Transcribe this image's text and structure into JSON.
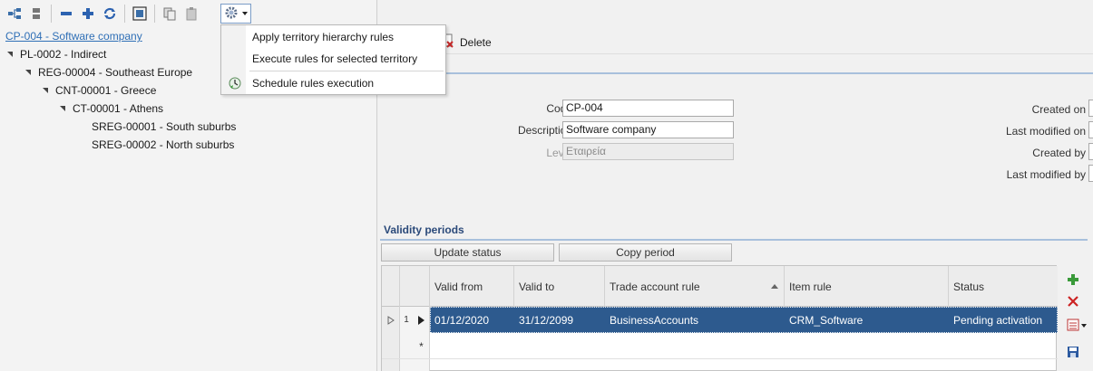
{
  "left_toolbar": {
    "icons": [
      "hierarchy-icon",
      "details-icon",
      "collapse-minus-icon",
      "add-plus-icon",
      "refresh-icon",
      "select-frame-icon",
      "copy-icon",
      "paste-icon",
      "gear-icon"
    ]
  },
  "menu": {
    "items": [
      {
        "label": "Apply territory hierarchy rules",
        "icon": ""
      },
      {
        "label": "Execute rules for selected territory",
        "icon": ""
      },
      {
        "label": "Schedule rules execution",
        "icon": "schedule-icon"
      }
    ]
  },
  "tree": {
    "root": "CP-004 - Software company",
    "nodes": [
      {
        "label": "PL-0002 - Indirect"
      },
      {
        "label": "REG-00004 - Southeast Europe"
      },
      {
        "label": "CNT-00001 - Greece"
      },
      {
        "label": "CT-00001 - Athens"
      },
      {
        "label": "SREG-00001 - South suburbs"
      },
      {
        "label": "SREG-00002 - North suburbs"
      }
    ]
  },
  "right_toolbar": {
    "delete_label": "Delete"
  },
  "form": {
    "code_label": "Code",
    "code_value": "CP-004",
    "description_label": "Description",
    "description_value": "Software company",
    "level_label": "Level",
    "level_value": "Εταιρεία",
    "created_on_label": "Created on",
    "last_modified_on_label": "Last modified on",
    "created_by_label": "Created by",
    "last_modified_by_label": "Last modified by"
  },
  "validity": {
    "title": "Validity periods",
    "update_status_label": "Update status",
    "copy_period_label": "Copy period",
    "columns": [
      "Valid from",
      "Valid to",
      "Trade account rule",
      "Item rule",
      "Status"
    ],
    "rows": [
      {
        "index": "1",
        "valid_from": "01/12/2020",
        "valid_to": "31/12/2099",
        "trade_account_rule": "BusinessAccounts",
        "item_rule": "CRM_Software",
        "status": "Pending activation"
      }
    ],
    "new_row_marker": "*"
  },
  "colors": {
    "selection": "#2d5a8e",
    "link": "#2f6fb6",
    "section_title": "#2b4a7a"
  }
}
